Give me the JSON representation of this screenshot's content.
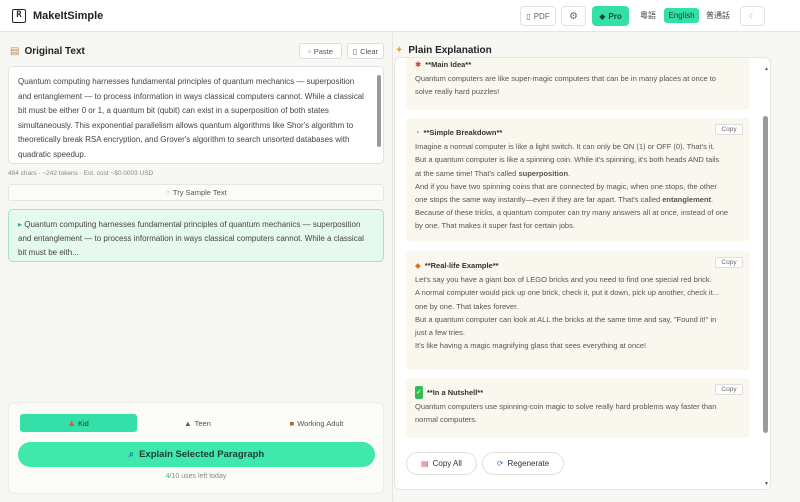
{
  "header": {
    "app_name": "MakeItSimple",
    "logo_letter": "R",
    "pdf_label": "PDF",
    "pro_label": "Pro",
    "languages": [
      "粵語",
      "English",
      "普通話"
    ],
    "active_language": "English"
  },
  "left": {
    "title": "Original Text",
    "paste_label": "Paste",
    "clear_label": "Clear",
    "original_text": "Quantum computing harnesses fundamental principles of quantum mechanics — superposition and entanglement — to process information in ways classical computers cannot. While a classical bit must be either 0 or 1, a quantum bit (qubit) can exist in a superposition of both states simultaneously. This exponential parallelism allows quantum algorithms like Shor's algorithm to theoretically break RSA encryption, and Grover's algorithm to search unsorted databases with quadratic speedup.",
    "stats": "484 chars · ~242 tokens · Est. cost ~$0.0003 USD",
    "sample_label": "Try Sample Text",
    "selected_text": "Quantum computing harnesses fundamental principles of quantum mechanics — superposition and entanglement — to process information in ways classical computers cannot. While a classical bit must be eith...",
    "audiences": [
      "Kid",
      "Teen",
      "Working Adult"
    ],
    "active_audience": "Kid",
    "explain_label": "Explain Selected Paragraph",
    "uses_count": "4",
    "uses_text": "/10 uses left today"
  },
  "right": {
    "title": "Plain Explanation",
    "copy_label": "Copy",
    "cards": [
      {
        "heading": "**Main Idea**",
        "lines": [
          "Quantum computers are like super-magic computers that can be in many places at once to",
          "solve really hard puzzles!"
        ]
      },
      {
        "heading": "**Simple Breakdown**",
        "line1": "Imagine a normal computer is like a light switch. It can only be ON (1) or OFF (0). That's it.",
        "line2": "But a quantum computer is like a spinning coin. While it's spinning, it's both heads AND tails",
        "line3_pre": "at the same time! That's called ",
        "line3_bold": "superposition",
        "line3_post": ".",
        "line4": "And if you have two spinning coins that are connected by magic, when one stops, the other",
        "line5_pre": "one stops the same way instantly—even if they are far apart. That's called ",
        "line5_bold": "entanglement",
        "line5_post": ".",
        "line6": "Because of these tricks, a quantum computer can try many answers all at once, instead of one",
        "line7": "by one. That makes it super fast for certain jobs."
      },
      {
        "heading": "**Real-life Example**",
        "lines": [
          "Let's say you have a giant box of LEGO bricks and you need to find one special red brick.",
          "A normal computer would pick up one brick, check it, put it down, pick up another, check it...",
          "one by one. That takes forever.",
          "But a quantum computer can look at ALL the bricks at the same time and say, \"Found it!\" in",
          "just a few tries.",
          "It's like having a magic magnifying glass that sees everything at once!"
        ]
      },
      {
        "heading": "**In a Nutshell**",
        "lines": [
          "Quantum computers use spinning-coin magic to solve really hard problems way faster than",
          "normal computers."
        ]
      }
    ],
    "copy_all_label": "Copy All",
    "regenerate_label": "Regenerate"
  },
  "colors": {
    "accent": "#35e0a8",
    "selected_bg": "#e6f9ee",
    "card_bg": "#f9f7ee"
  }
}
